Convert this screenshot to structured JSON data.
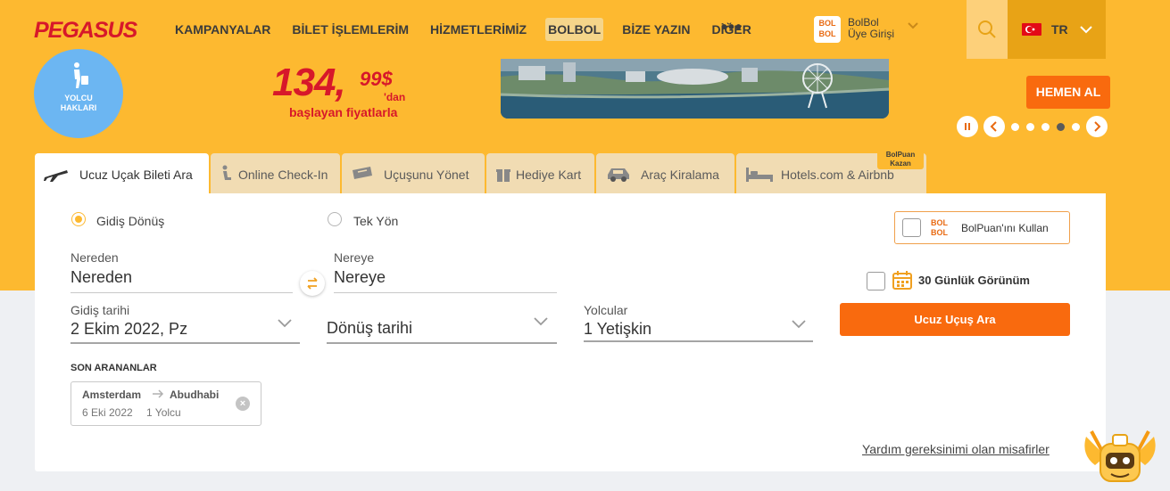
{
  "header": {
    "logo": "PEGASUS",
    "nav": [
      "KAMPANYALAR",
      "BİLET İŞLEMLERİM",
      "HİZMETLERİMİZ",
      "BOLBOL",
      "BİZE YAZIN",
      "DİĞER"
    ],
    "more": "•••",
    "bolbol_login": {
      "logo_top": "BOL",
      "logo_bottom": "BOL",
      "line1": "BolBol",
      "line2": "Üye Girişi"
    },
    "language": "TR"
  },
  "banner": {
    "rights_badge": {
      "line1": "YOLCU",
      "line2": "HAKLARI"
    },
    "price_main": "134,",
    "price_cents": "99$",
    "price_suffix": "'dan",
    "price_sub": "başlayan fiyatlarla",
    "cta": "HEMEN AL",
    "carousel_dots": 5,
    "carousel_active": 4
  },
  "tabs": [
    {
      "label": "Ucuz Uçak Bileti Ara",
      "icon": "plane-icon",
      "active": true
    },
    {
      "label": "Online Check-In",
      "icon": "check-in-icon",
      "active": false
    },
    {
      "label": "Uçuşunu Yönet",
      "icon": "ticket-icon",
      "active": false
    },
    {
      "label": "Hediye Kart",
      "icon": "gift-icon",
      "active": false
    },
    {
      "label": "Araç Kiralama",
      "icon": "car-icon",
      "active": false
    },
    {
      "label": "Hotels.com & Airbnb",
      "icon": "bed-icon",
      "active": false
    }
  ],
  "bolpuan_tag": {
    "line1": "BolPuan",
    "line2": "Kazan"
  },
  "search": {
    "trip_type": {
      "round": "Gidiş Dönüş",
      "oneway": "Tek Yön",
      "selected": "round"
    },
    "from": {
      "label": "Nereden",
      "value": "Nereden"
    },
    "to": {
      "label": "Nereye",
      "value": "Nereye"
    },
    "depart": {
      "label": "Gidiş tarihi",
      "value": "2 Ekim 2022, Pz"
    },
    "return": {
      "value": "Dönüş tarihi"
    },
    "passengers": {
      "label": "Yolcular",
      "value": "1 Yetişkin"
    },
    "bolpuan": {
      "logo_top": "BOL",
      "logo_bottom": "BOL",
      "label": "BolPuan'ını Kullan"
    },
    "calendar_view": "30 Günlük Görünüm",
    "submit": "Ucuz Uçuş Ara"
  },
  "recent": {
    "title": "SON ARANANLAR",
    "items": [
      {
        "from": "Amsterdam",
        "to": "Abudhabi",
        "date": "6 Eki 2022",
        "pax": "1 Yolcu"
      }
    ]
  },
  "help_link": "Yardım gereksinimi olan misafirler",
  "colors": {
    "brand_yellow": "#fdb930",
    "accent_orange": "#f96a0e",
    "logo_red": "#d7182a"
  }
}
